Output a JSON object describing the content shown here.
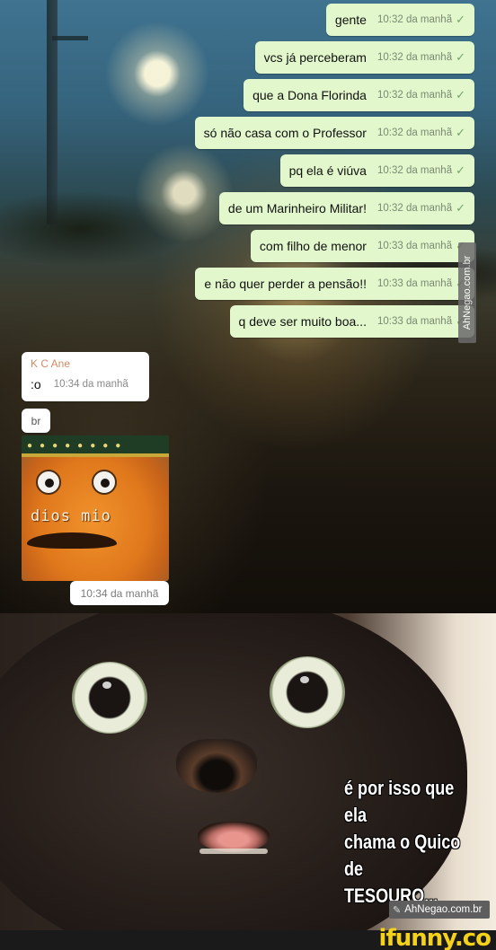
{
  "outgoing": [
    {
      "text": "gente",
      "time": "10:32 da manhã",
      "tick": "✓"
    },
    {
      "text": "vcs já perceberam",
      "time": "10:32 da manhã",
      "tick": "✓"
    },
    {
      "text": "que a Dona Florinda",
      "time": "10:32 da manhã",
      "tick": "✓"
    },
    {
      "text": "só não casa com o Professor",
      "time": "10:32 da manhã",
      "tick": "✓"
    },
    {
      "text": "pq ela é viúva",
      "time": "10:32 da manhã",
      "tick": "✓"
    },
    {
      "text": "de um Marinheiro Militar!",
      "time": "10:32 da manhã",
      "tick": "✓"
    },
    {
      "text": "com filho de menor",
      "time": "10:33 da manhã",
      "tick": "✓"
    },
    {
      "text": "e não quer perder a pensão!!",
      "time": "10:33 da manhã",
      "tick": "✓"
    },
    {
      "text": "q deve ser muito boa...",
      "time": "10:33 da manhã",
      "tick": "✓"
    }
  ],
  "incoming": {
    "sender": "K C Ane",
    "text": ":o",
    "time": "10:34 da manhã",
    "prefix": "br"
  },
  "sticker": {
    "caption": "dios mio",
    "time": "10:34 da manhã"
  },
  "watermark_side": "AhNegao.com.br",
  "meme": {
    "caption_lines": [
      "é por isso que ela",
      "chama o Quico de",
      "TESOURO..."
    ],
    "watermark": "AhNegao.com.br",
    "brand": "ifunny.co"
  },
  "colors": {
    "outgoing_bubble": "#e2f7cb",
    "incoming_bubble": "#ffffff",
    "sender_name": "#d08a64",
    "brand": "#f5d21a"
  }
}
